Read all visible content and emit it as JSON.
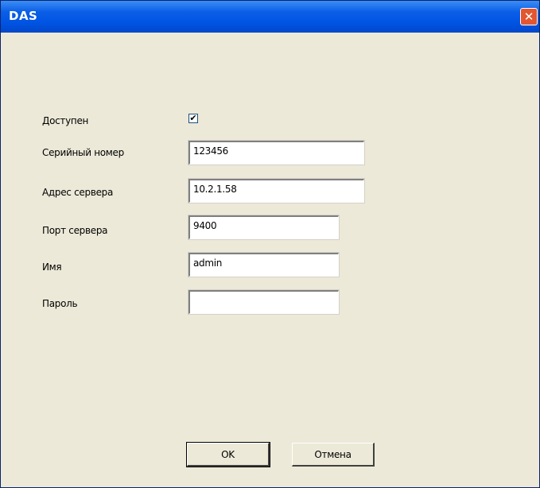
{
  "window": {
    "title": "DAS",
    "close_glyph": "✕"
  },
  "form": {
    "enabled_label": "Доступен",
    "enabled_checked": true,
    "serial_label": "Серийный номер",
    "serial_value": "123456",
    "address_label": "Адрес сервера",
    "address_value": "10.2.1.58",
    "port_label": "Порт сервера",
    "port_value": "9400",
    "name_label": "Имя",
    "name_value": "admin",
    "password_label": "Пароль",
    "password_value": ""
  },
  "buttons": {
    "ok": "OK",
    "cancel": "Отмена"
  },
  "colors": {
    "titlebar": "#0054e3",
    "dialog_bg": "#ece9d8",
    "close_button": "#e3562f"
  }
}
